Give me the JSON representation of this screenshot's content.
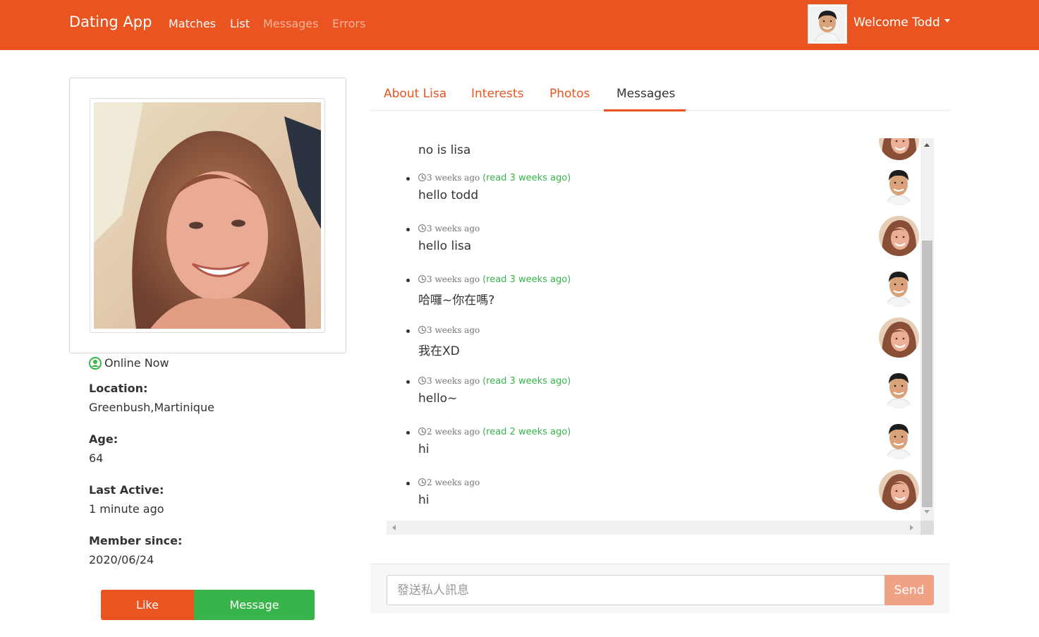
{
  "navbar": {
    "brand": "Dating App",
    "links": [
      {
        "label": "Matches",
        "state": "active"
      },
      {
        "label": "List",
        "state": "active"
      },
      {
        "label": "Messages",
        "state": "dim"
      },
      {
        "label": "Errors",
        "state": "dim"
      }
    ],
    "welcome": "Welcome Todd"
  },
  "profile": {
    "status": "Online Now",
    "location_label": "Location:",
    "location": "Greenbush,Martinique",
    "age_label": "Age:",
    "age": "64",
    "last_active_label": "Last Active:",
    "last_active": "1 minute ago",
    "member_since_label": "Member since:",
    "member_since": "2020/06/24",
    "like_button": "Like",
    "message_button": "Message"
  },
  "tabs": [
    {
      "label": "About Lisa",
      "active": false
    },
    {
      "label": "Interests",
      "active": false
    },
    {
      "label": "Photos",
      "active": false
    },
    {
      "label": "Messages",
      "active": true
    }
  ],
  "messages": [
    {
      "time": "",
      "read": "",
      "text": "no is lisa",
      "sender": "lisa"
    },
    {
      "time": "3 weeks ago",
      "read": "(read 3 weeks ago)",
      "text": "hello todd",
      "sender": "todd"
    },
    {
      "time": "3 weeks ago",
      "read": "",
      "text": "hello lisa",
      "sender": "lisa"
    },
    {
      "time": "3 weeks ago",
      "read": "(read 3 weeks ago)",
      "text": "哈囉~你在嗎?",
      "sender": "todd"
    },
    {
      "time": "3 weeks ago",
      "read": "",
      "text": "我在XD",
      "sender": "lisa"
    },
    {
      "time": "3 weeks ago",
      "read": "(read 3 weeks ago)",
      "text": "hello~",
      "sender": "todd"
    },
    {
      "time": "2 weeks ago",
      "read": "(read 2 weeks ago)",
      "text": "hi",
      "sender": "todd"
    },
    {
      "time": "2 weeks ago",
      "read": "",
      "text": "hi",
      "sender": "lisa"
    }
  ],
  "composer": {
    "placeholder": "發送私人訊息",
    "send_label": "Send"
  },
  "colors": {
    "brand": "#e95420",
    "success": "#38b44a",
    "send_disabled": "#f0a285"
  }
}
